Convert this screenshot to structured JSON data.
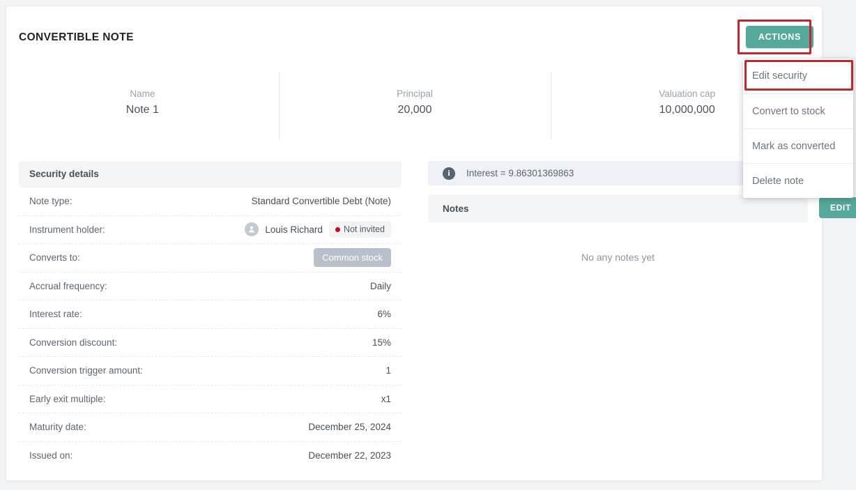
{
  "header": {
    "title": "CONVERTIBLE NOTE",
    "actions_label": "ACTIONS"
  },
  "dropdown": {
    "items": [
      {
        "label": "Edit security"
      },
      {
        "label": "Convert to stock"
      },
      {
        "label": "Mark as converted"
      },
      {
        "label": "Delete note"
      }
    ],
    "highlighted_item": "Edit security"
  },
  "stats": [
    {
      "label": "Name",
      "value": "Note 1"
    },
    {
      "label": "Principal",
      "value": "20,000"
    },
    {
      "label": "Valuation cap",
      "value": "10,000,000"
    }
  ],
  "security_details": {
    "header": "Security details",
    "rows": [
      {
        "key": "Note type:",
        "value": "Standard Convertible Debt (Note)"
      },
      {
        "key": "Instrument holder:",
        "value": "Louis Richard",
        "status": "Not invited"
      },
      {
        "key": "Converts to:",
        "badge": "Common stock"
      },
      {
        "key": "Accrual frequency:",
        "value": "Daily"
      },
      {
        "key": "Interest rate:",
        "value": "6%"
      },
      {
        "key": "Conversion discount:",
        "value": "15%"
      },
      {
        "key": "Conversion trigger amount:",
        "value": "1"
      },
      {
        "key": "Early exit multiple:",
        "value": "x1"
      },
      {
        "key": "Maturity date:",
        "value": "December 25, 2024"
      },
      {
        "key": "Issued on:",
        "value": "December 22, 2023"
      }
    ]
  },
  "notes_panel": {
    "info_icon": "info-icon",
    "info_text": "Interest = 9.86301369863",
    "title": "Notes",
    "edit_label": "EDIT",
    "empty_text": "No any notes yet"
  },
  "colors": {
    "accent_teal": "#55a99b",
    "highlight_red": "#c0272d",
    "status_red": "#d0021b",
    "badge_gray": "#b8c0cc",
    "panel_gray": "#f4f5f6",
    "info_banner_blue": "#eef1f7"
  }
}
